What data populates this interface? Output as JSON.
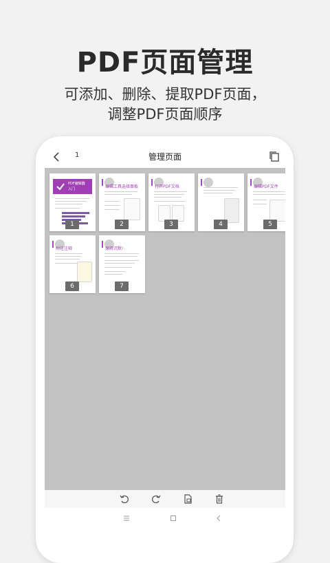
{
  "hero": {
    "title": "PDF页面管理",
    "subtitle_line1": "可添加、删除、提取PDF页面，",
    "subtitle_line2": "调整PDF页面顺序"
  },
  "screen": {
    "page_indicator": "1",
    "title": "管理页面"
  },
  "thumbnails": [
    {
      "number": "1",
      "title": "PDF编辑器",
      "subtitle": "入门"
    },
    {
      "number": "2",
      "title": "编辑工具选择面板"
    },
    {
      "number": "3",
      "title": "打开PDF文档"
    },
    {
      "number": "4",
      "title": ""
    },
    {
      "number": "5",
      "title": "编辑PDF文件"
    },
    {
      "number": "6",
      "title": "附注注释"
    },
    {
      "number": "7",
      "title": "保持沉默!"
    }
  ],
  "colors": {
    "accent": "#a548b8",
    "grid_background": "#c2c2c2",
    "page_background": "#f2f2f2"
  },
  "toolbar_icons": [
    "rotate-left-icon",
    "rotate-right-icon",
    "extract-page-icon",
    "delete-icon"
  ],
  "nav_icons": [
    "menu-icon",
    "home-icon",
    "back-icon"
  ]
}
